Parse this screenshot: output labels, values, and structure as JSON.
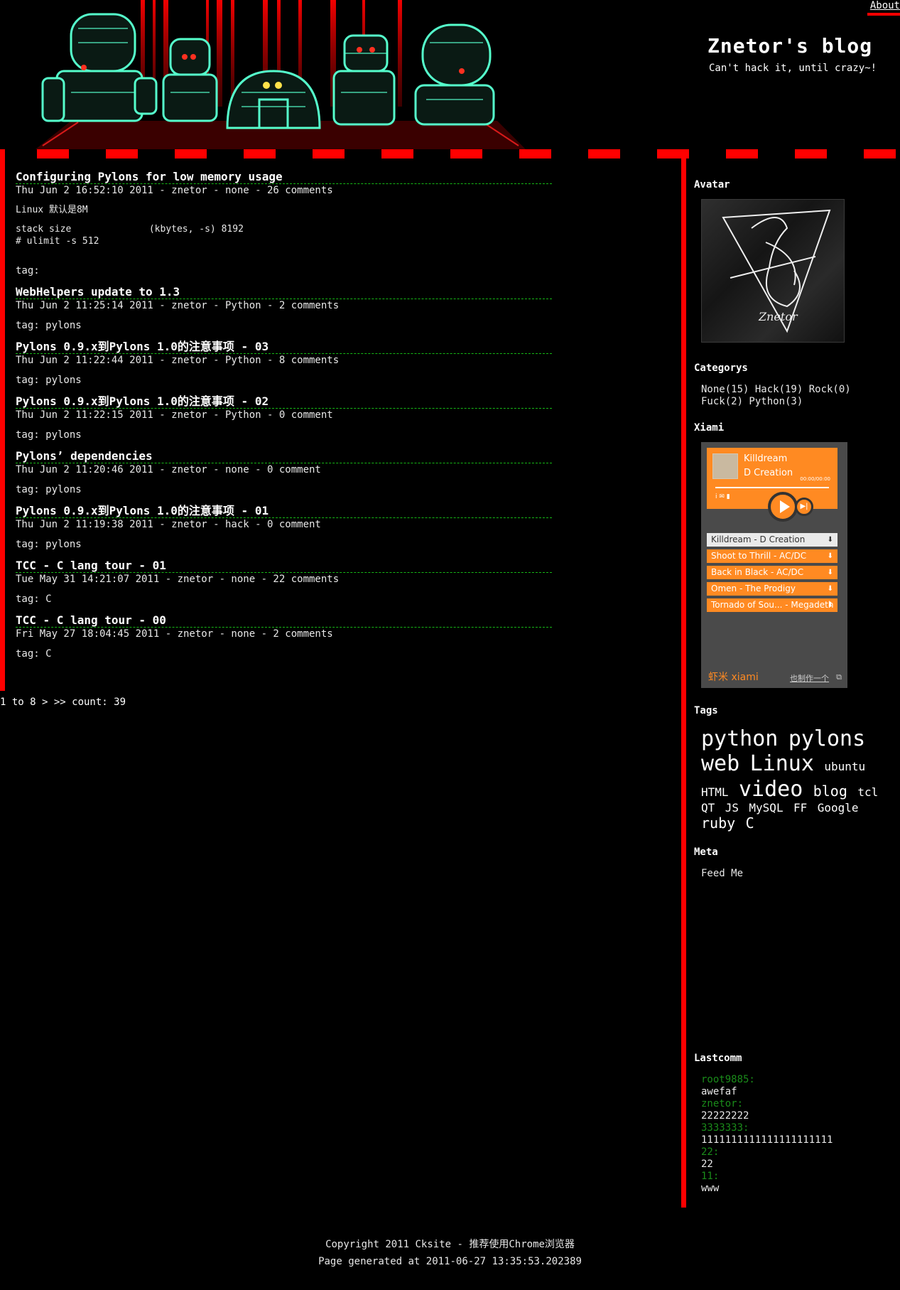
{
  "header": {
    "about": "About",
    "title": "Znetor's blog",
    "tagline": "Can't hack it, until crazy~!"
  },
  "posts": [
    {
      "title": "Configuring Pylons for low memory usage",
      "meta": "Thu Jun 2 16:52:10 2011 - znetor - none - 26 comments",
      "body": [
        "Linux 默认是8M",
        "stack size              (kbytes, -s) 8192\n# ulimit -s 512"
      ],
      "tag": "tag:"
    },
    {
      "title": "WebHelpers update to 1.3",
      "meta": "Thu Jun 2 11:25:14 2011 - znetor - Python - 2 comments",
      "tag": "tag: pylons"
    },
    {
      "title": "Pylons 0.9.x到Pylons 1.0的注意事项 - 03",
      "meta": "Thu Jun 2 11:22:44 2011 - znetor - Python - 8 comments",
      "tag": "tag: pylons"
    },
    {
      "title": "Pylons 0.9.x到Pylons 1.0的注意事项 - 02",
      "meta": "Thu Jun 2 11:22:15 2011 - znetor - Python - 0 comment",
      "tag": "tag: pylons"
    },
    {
      "title": "Pylons’ dependencies",
      "meta": "Thu Jun 2 11:20:46 2011 - znetor - none - 0 comment",
      "tag": "tag: pylons"
    },
    {
      "title": "Pylons 0.9.x到Pylons 1.0的注意事项 - 01",
      "meta": "Thu Jun 2 11:19:38 2011 - znetor - hack - 0 comment",
      "tag": "tag: pylons"
    },
    {
      "title": "TCC - C lang tour - 01",
      "meta": "Tue May 31 14:21:07 2011 - znetor - none - 22 comments",
      "tag": "tag: C"
    },
    {
      "title": "TCC - C lang tour - 00",
      "meta": "Fri May 27 18:04:45 2011 - znetor - none - 2 comments",
      "tag": "tag: C"
    }
  ],
  "pagination": "1 to 8 > >> count: 39",
  "sidebar": {
    "avatar_title": "Avatar",
    "categories_title": "Categorys",
    "categories_text": "None(15) Hack(19) Rock(0) Fuck(2) Python(3)",
    "xiami_title": "Xiami",
    "xiami": {
      "song": "Killdream",
      "artist": "D Creation",
      "time": "00:00/00:00",
      "playlist": [
        "Killdream - D Creation",
        "Shoot to Thrill - AC/DC",
        "Back in Black - AC/DC",
        "Omen - The Prodigy",
        "Tornado of Sou... - Megadeth"
      ],
      "logo": "虾米 xiami",
      "make": "也制作一个"
    },
    "tags_title": "Tags",
    "tags": [
      {
        "name": "python",
        "size": 30
      },
      {
        "name": "pylons",
        "size": 30
      },
      {
        "name": "web",
        "size": 30
      },
      {
        "name": "Linux",
        "size": 30
      },
      {
        "name": "ubuntu",
        "size": 16
      },
      {
        "name": "HTML",
        "size": 16
      },
      {
        "name": "video",
        "size": 30
      },
      {
        "name": "blog",
        "size": 20
      },
      {
        "name": "tcl",
        "size": 16
      },
      {
        "name": "QT",
        "size": 16
      },
      {
        "name": "JS",
        "size": 16
      },
      {
        "name": "MySQL",
        "size": 16
      },
      {
        "name": "FF",
        "size": 16
      },
      {
        "name": "Google",
        "size": 16
      },
      {
        "name": "ruby",
        "size": 20
      },
      {
        "name": "C",
        "size": 20
      }
    ],
    "meta_title": "Meta",
    "feed": "Feed Me",
    "lastcomm_title": "Lastcomm",
    "comments": [
      {
        "author": "root9885:",
        "text": "awefaf"
      },
      {
        "author": "znetor:",
        "text": "22222222"
      },
      {
        "author": "3333333:",
        "text": "1111111111111111111111"
      },
      {
        "author": "22:",
        "text": "22"
      },
      {
        "author": "11:",
        "text": "www"
      }
    ]
  },
  "footer": {
    "copyright": "Copyright 2011 Cksite - 推荐使用Chrome浏览器",
    "generated": "Page generated at 2011-06-27 13:35:53.202389"
  },
  "colors": {
    "accent": "#ff0000",
    "title_rule": "#16b816",
    "robot_glow": "#55ffcc",
    "xiami_orange": "#ff8a22"
  }
}
